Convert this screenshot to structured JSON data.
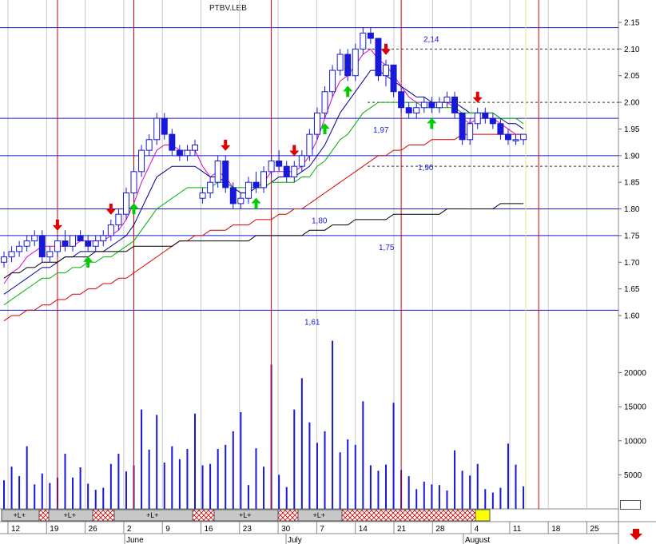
{
  "window_title": "PTBV.LEB",
  "colors": {
    "bull_candle": "#ffffff",
    "bear_candle": "#1818d8",
    "candle_outline": "#1818d8",
    "ema_fast": "#e000c8",
    "ema_mid": "#000090",
    "ema_slow": "#00b000",
    "ma_long": "#d80000",
    "ma_vlong": "#000000",
    "level_line": "#1818d8",
    "signal_line": "#d80000",
    "volume_bar": "#1818d8",
    "buy_arrow": "#00cc00",
    "sell_arrow": "#e00000",
    "highlight": "#ffff00"
  },
  "chart_data": {
    "type": "candlestick",
    "price_axis": {
      "ylim": [
        1.6,
        2.15
      ],
      "ticks": [
        "2.15",
        "2.10",
        "2.05",
        "2.00",
        "1.95",
        "1.90",
        "1.85",
        "1.80",
        "1.75",
        "1.70",
        "1.65",
        "1.60"
      ]
    },
    "volume_axis": {
      "ylim": [
        0,
        25000
      ],
      "ticks": [
        "20000",
        "15000",
        "10000",
        "5000"
      ]
    },
    "x_tick_labels": [
      "12",
      "19",
      "26",
      "2",
      "9",
      "16",
      "23",
      "30",
      "7",
      "14",
      "21",
      "28",
      "4",
      "11",
      "18",
      "25"
    ],
    "month_labels": [
      "June",
      "July",
      "August"
    ],
    "ohlc": [
      [
        1.7,
        1.72,
        1.69,
        1.71
      ],
      [
        1.71,
        1.73,
        1.7,
        1.72
      ],
      [
        1.72,
        1.74,
        1.71,
        1.73
      ],
      [
        1.73,
        1.75,
        1.72,
        1.74
      ],
      [
        1.74,
        1.76,
        1.73,
        1.75
      ],
      [
        1.75,
        1.76,
        1.7,
        1.71
      ],
      [
        1.71,
        1.73,
        1.7,
        1.72
      ],
      [
        1.72,
        1.75,
        1.71,
        1.74
      ],
      [
        1.74,
        1.76,
        1.72,
        1.73
      ],
      [
        1.73,
        1.75,
        1.72,
        1.75
      ],
      [
        1.75,
        1.76,
        1.74,
        1.74
      ],
      [
        1.74,
        1.75,
        1.72,
        1.73
      ],
      [
        1.73,
        1.75,
        1.72,
        1.74
      ],
      [
        1.74,
        1.76,
        1.73,
        1.75
      ],
      [
        1.75,
        1.78,
        1.74,
        1.77
      ],
      [
        1.77,
        1.8,
        1.76,
        1.79
      ],
      [
        1.79,
        1.84,
        1.78,
        1.83
      ],
      [
        1.83,
        1.88,
        1.82,
        1.87
      ],
      [
        1.87,
        1.92,
        1.86,
        1.91
      ],
      [
        1.91,
        1.94,
        1.9,
        1.93
      ],
      [
        1.93,
        1.98,
        1.92,
        1.97
      ],
      [
        1.97,
        1.98,
        1.93,
        1.94
      ],
      [
        1.94,
        1.95,
        1.9,
        1.91
      ],
      [
        1.91,
        1.92,
        1.89,
        1.9
      ],
      [
        1.9,
        1.92,
        1.89,
        1.91
      ],
      [
        1.91,
        1.93,
        1.9,
        1.92
      ],
      [
        1.82,
        1.84,
        1.81,
        1.83
      ],
      [
        1.83,
        1.86,
        1.82,
        1.85
      ],
      [
        1.85,
        1.9,
        1.84,
        1.89
      ],
      [
        1.89,
        1.9,
        1.83,
        1.84
      ],
      [
        1.84,
        1.85,
        1.8,
        1.81
      ],
      [
        1.81,
        1.83,
        1.8,
        1.82
      ],
      [
        1.82,
        1.86,
        1.81,
        1.85
      ],
      [
        1.85,
        1.87,
        1.83,
        1.84
      ],
      [
        1.84,
        1.88,
        1.83,
        1.87
      ],
      [
        1.87,
        1.9,
        1.86,
        1.89
      ],
      [
        1.89,
        1.91,
        1.87,
        1.88
      ],
      [
        1.88,
        1.89,
        1.85,
        1.86
      ],
      [
        1.86,
        1.89,
        1.85,
        1.88
      ],
      [
        1.88,
        1.91,
        1.87,
        1.9
      ],
      [
        1.9,
        1.95,
        1.89,
        1.94
      ],
      [
        1.94,
        1.99,
        1.93,
        1.98
      ],
      [
        1.98,
        2.03,
        1.97,
        2.02
      ],
      [
        2.02,
        2.07,
        2.01,
        2.06
      ],
      [
        2.06,
        2.1,
        2.05,
        2.09
      ],
      [
        2.09,
        2.1,
        2.04,
        2.05
      ],
      [
        2.05,
        2.11,
        2.04,
        2.1
      ],
      [
        2.1,
        2.14,
        2.09,
        2.13
      ],
      [
        2.13,
        2.14,
        2.11,
        2.12
      ],
      [
        2.12,
        2.12,
        2.04,
        2.05
      ],
      [
        2.05,
        2.08,
        2.03,
        2.07
      ],
      [
        2.07,
        2.07,
        2.01,
        2.02
      ],
      [
        2.02,
        2.03,
        1.98,
        1.99
      ],
      [
        1.99,
        2.0,
        1.97,
        1.98
      ],
      [
        1.98,
        2.0,
        1.97,
        1.99
      ],
      [
        1.99,
        2.01,
        1.98,
        2.0
      ],
      [
        2.0,
        2.01,
        1.98,
        1.99
      ],
      [
        1.99,
        2.01,
        1.98,
        2.0
      ],
      [
        2.0,
        2.02,
        1.99,
        2.01
      ],
      [
        2.01,
        2.02,
        1.97,
        1.98
      ],
      [
        1.98,
        1.98,
        1.92,
        1.93
      ],
      [
        1.93,
        1.97,
        1.92,
        1.96
      ],
      [
        1.96,
        1.99,
        1.95,
        1.98
      ],
      [
        1.98,
        1.99,
        1.96,
        1.97
      ],
      [
        1.97,
        1.98,
        1.95,
        1.96
      ],
      [
        1.96,
        1.97,
        1.93,
        1.94
      ],
      [
        1.94,
        1.95,
        1.92,
        1.93
      ],
      [
        1.93,
        1.94,
        1.92,
        1.93
      ],
      [
        1.93,
        1.94,
        1.92,
        1.94
      ]
    ],
    "volume": [
      4200,
      6200,
      4800,
      9200,
      3600,
      5200,
      3800,
      4600,
      8100,
      4600,
      6100,
      3700,
      2800,
      3100,
      6600,
      8100,
      5500,
      6400,
      14600,
      8700,
      13800,
      6800,
      9200,
      7300,
      8800,
      14000,
      6400,
      6600,
      8800,
      9400,
      11400,
      14200,
      3500,
      8900,
      6200,
      21200,
      5000,
      3200,
      14600,
      19200,
      12700,
      9700,
      11400,
      24700,
      8300,
      10200,
      9400,
      15800,
      6400,
      5600,
      6500,
      15600,
      5700,
      4800,
      2900,
      4000,
      3600,
      3500,
      2700,
      8600,
      5600,
      4900,
      6600,
      2900,
      2400,
      3100,
      9600,
      6500,
      3300
    ],
    "indicator_series": [
      {
        "name": "EMA fast",
        "values": [
          1.66,
          1.68,
          1.69,
          1.71,
          1.72,
          1.73,
          1.73,
          1.73,
          1.73,
          1.73,
          1.74,
          1.74,
          1.74,
          1.74,
          1.75,
          1.76,
          1.78,
          1.81,
          1.85,
          1.88,
          1.91,
          1.92,
          1.92,
          1.91,
          1.91,
          1.91,
          1.88,
          1.86,
          1.87,
          1.86,
          1.84,
          1.83,
          1.83,
          1.84,
          1.85,
          1.87,
          1.87,
          1.87,
          1.87,
          1.88,
          1.9,
          1.93,
          1.97,
          2.01,
          2.04,
          2.05,
          2.07,
          2.09,
          2.1,
          2.08,
          2.07,
          2.05,
          2.03,
          2.01,
          2.0,
          2.0,
          2.0,
          2.0,
          2.0,
          1.99,
          1.97,
          1.96,
          1.97,
          1.97,
          1.97,
          1.96,
          1.95,
          1.94,
          1.94
        ]
      },
      {
        "name": "EMA mid",
        "values": [
          1.64,
          1.65,
          1.66,
          1.67,
          1.68,
          1.69,
          1.69,
          1.7,
          1.71,
          1.71,
          1.72,
          1.72,
          1.72,
          1.72,
          1.73,
          1.74,
          1.75,
          1.77,
          1.8,
          1.83,
          1.86,
          1.87,
          1.88,
          1.88,
          1.88,
          1.88,
          1.87,
          1.86,
          1.86,
          1.85,
          1.84,
          1.83,
          1.83,
          1.84,
          1.84,
          1.85,
          1.86,
          1.86,
          1.86,
          1.87,
          1.88,
          1.9,
          1.92,
          1.95,
          1.98,
          2.0,
          2.02,
          2.04,
          2.06,
          2.06,
          2.05,
          2.04,
          2.03,
          2.02,
          2.01,
          2.01,
          2.0,
          2.0,
          2.0,
          2.0,
          1.99,
          1.98,
          1.98,
          1.98,
          1.98,
          1.97,
          1.96,
          1.96,
          1.95
        ]
      },
      {
        "name": "EMA slow",
        "values": [
          1.62,
          1.63,
          1.64,
          1.65,
          1.66,
          1.67,
          1.67,
          1.68,
          1.68,
          1.69,
          1.69,
          1.7,
          1.7,
          1.71,
          1.71,
          1.72,
          1.73,
          1.74,
          1.76,
          1.78,
          1.8,
          1.81,
          1.82,
          1.83,
          1.84,
          1.84,
          1.84,
          1.84,
          1.85,
          1.85,
          1.84,
          1.84,
          1.84,
          1.84,
          1.84,
          1.85,
          1.85,
          1.85,
          1.85,
          1.86,
          1.86,
          1.88,
          1.89,
          1.91,
          1.93,
          1.94,
          1.96,
          1.98,
          1.99,
          2.0,
          2.0,
          2.0,
          2.0,
          2.0,
          2.0,
          1.99,
          1.99,
          1.99,
          1.99,
          1.99,
          1.98,
          1.98,
          1.98,
          1.98,
          1.98,
          1.97,
          1.97,
          1.97,
          1.96
        ]
      },
      {
        "name": "MA long",
        "values": [
          1.59,
          1.6,
          1.6,
          1.61,
          1.61,
          1.62,
          1.62,
          1.63,
          1.63,
          1.64,
          1.64,
          1.65,
          1.65,
          1.66,
          1.66,
          1.67,
          1.67,
          1.68,
          1.69,
          1.7,
          1.71,
          1.72,
          1.73,
          1.74,
          1.74,
          1.75,
          1.75,
          1.76,
          1.76,
          1.76,
          1.77,
          1.77,
          1.77,
          1.78,
          1.78,
          1.78,
          1.79,
          1.79,
          1.8,
          1.8,
          1.81,
          1.82,
          1.83,
          1.84,
          1.85,
          1.86,
          1.87,
          1.88,
          1.89,
          1.9,
          1.9,
          1.91,
          1.91,
          1.92,
          1.92,
          1.92,
          1.93,
          1.93,
          1.93,
          1.93,
          1.94,
          1.94,
          1.94,
          1.94,
          1.94,
          1.94,
          1.94,
          1.94,
          1.94
        ]
      },
      {
        "name": "MA very long",
        "values": [
          1.67,
          1.68,
          1.68,
          1.69,
          1.69,
          1.7,
          1.7,
          1.7,
          1.71,
          1.71,
          1.71,
          1.71,
          1.72,
          1.72,
          1.72,
          1.72,
          1.72,
          1.73,
          1.73,
          1.73,
          1.73,
          1.73,
          1.73,
          1.74,
          1.74,
          1.74,
          1.74,
          1.74,
          1.74,
          1.74,
          1.74,
          1.74,
          1.74,
          1.75,
          1.75,
          1.75,
          1.75,
          1.75,
          1.75,
          1.75,
          1.76,
          1.76,
          1.76,
          1.77,
          1.77,
          1.77,
          1.78,
          1.78,
          1.78,
          1.78,
          1.78,
          1.79,
          1.79,
          1.79,
          1.79,
          1.79,
          1.79,
          1.79,
          1.8,
          1.8,
          1.8,
          1.8,
          1.8,
          1.8,
          1.8,
          1.81,
          1.81,
          1.81,
          1.81
        ]
      }
    ],
    "level_lines": [
      {
        "label": "2,14",
        "value": 2.14,
        "style": "solid"
      },
      {
        "label": "",
        "value": 2.1,
        "style": "dashed"
      },
      {
        "label": "",
        "value": 2.0,
        "style": "dashed"
      },
      {
        "label": "1,97",
        "value": 1.97,
        "style": "solid"
      },
      {
        "label": "1,90",
        "value": 1.9,
        "style": "solid"
      },
      {
        "label": "",
        "value": 1.88,
        "style": "dashed"
      },
      {
        "label": "1,80",
        "value": 1.8,
        "style": "solid"
      },
      {
        "label": "1,75",
        "value": 1.75,
        "style": "solid"
      },
      {
        "label": "1,61",
        "value": 1.61,
        "style": "solid"
      }
    ],
    "sell_signals_idx": [
      7,
      14,
      29,
      38,
      50,
      62,
      75,
      84
    ],
    "buy_signals_idx": [
      11,
      17,
      33,
      42,
      45,
      56,
      70,
      81,
      87
    ],
    "signal_vertical_idx": [
      7,
      17,
      35,
      52,
      70
    ],
    "strip": {
      "segments": [
        {
          "label": "+L+",
          "type": "bull"
        },
        {
          "label": "",
          "type": "bear"
        },
        {
          "label": "+L+",
          "type": "bull"
        },
        {
          "label": "",
          "type": "bear"
        },
        {
          "label": "+L+",
          "type": "bull"
        },
        {
          "label": "",
          "type": "bear"
        },
        {
          "label": "+L+",
          "type": "bull"
        },
        {
          "label": "",
          "type": "bear"
        },
        {
          "label": "+L+",
          "type": "bull"
        },
        {
          "label": "",
          "type": "bear"
        },
        {
          "label": "",
          "type": "current"
        }
      ]
    }
  }
}
